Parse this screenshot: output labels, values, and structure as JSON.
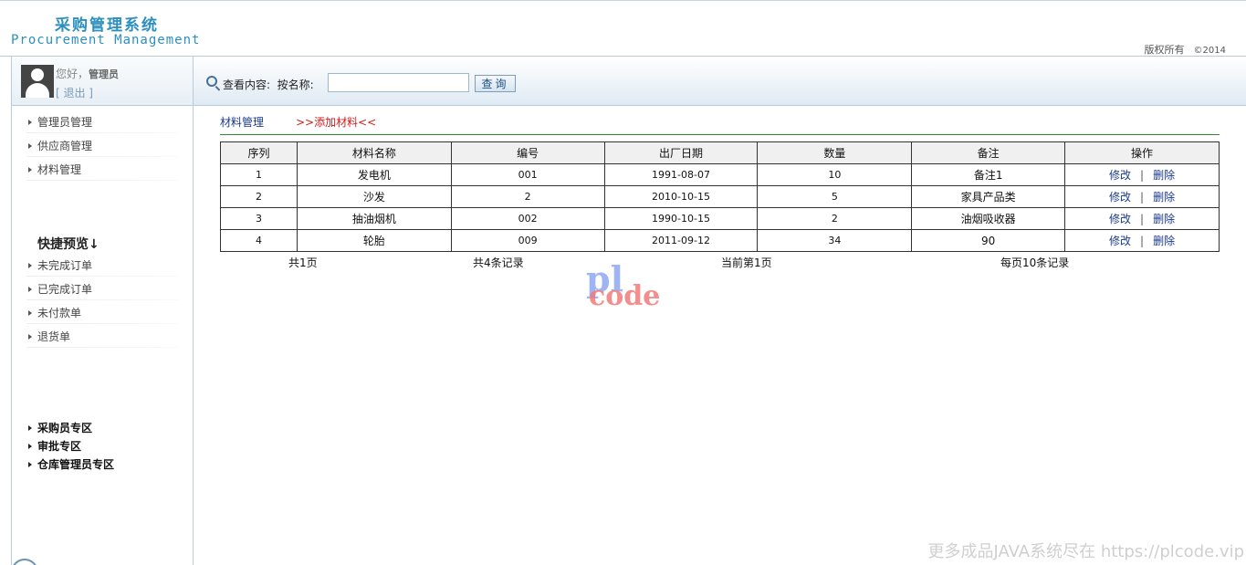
{
  "header": {
    "title_cn": "采购管理系统",
    "title_en": "Procurement Management",
    "copyright": "版权所有",
    "year": "©2014"
  },
  "user": {
    "greeting": "您好，",
    "name": "管理员",
    "logout": "[ 退出 ]"
  },
  "nav": {
    "items": [
      "管理员管理",
      "供应商管理",
      "材料管理"
    ]
  },
  "quick": {
    "title": "快捷预览↓",
    "items": [
      "未完成订单",
      "已完成订单",
      "未付款单",
      "退货单"
    ]
  },
  "zones": {
    "items": [
      "采购员专区",
      "审批专区",
      "仓库管理员专区"
    ]
  },
  "search": {
    "label": "查看内容:  按名称:",
    "placeholder": "",
    "value": "",
    "button": "查询"
  },
  "breadcrumb": {
    "current": "材料管理",
    "add": ">>添加材料<<"
  },
  "table": {
    "headers": [
      "序列",
      "材料名称",
      "编号",
      "出厂日期",
      "数量",
      "备注",
      "操作"
    ],
    "rows": [
      [
        "1",
        "发电机",
        "001",
        "1991-08-07",
        "10",
        "备注1"
      ],
      [
        "2",
        "沙发",
        "2",
        "2010-10-15",
        "5",
        "家具产品类"
      ],
      [
        "3",
        "抽油烟机",
        "002",
        "1990-10-15",
        "2",
        "油烟吸收器"
      ],
      [
        "4",
        "轮胎",
        "009",
        "2011-09-12",
        "34",
        "90"
      ]
    ],
    "edit": "修改",
    "separator": "|",
    "delete": "删除"
  },
  "pager": {
    "total_pages": "共1页",
    "total_records": "共4条记录",
    "current_page": "当前第1页",
    "per_page": "每页10条记录"
  },
  "watermark": {
    "top": "pl",
    "bottom": "code"
  },
  "footer_note": "更多成品JAVA系统尽在 https://plcode.vip"
}
